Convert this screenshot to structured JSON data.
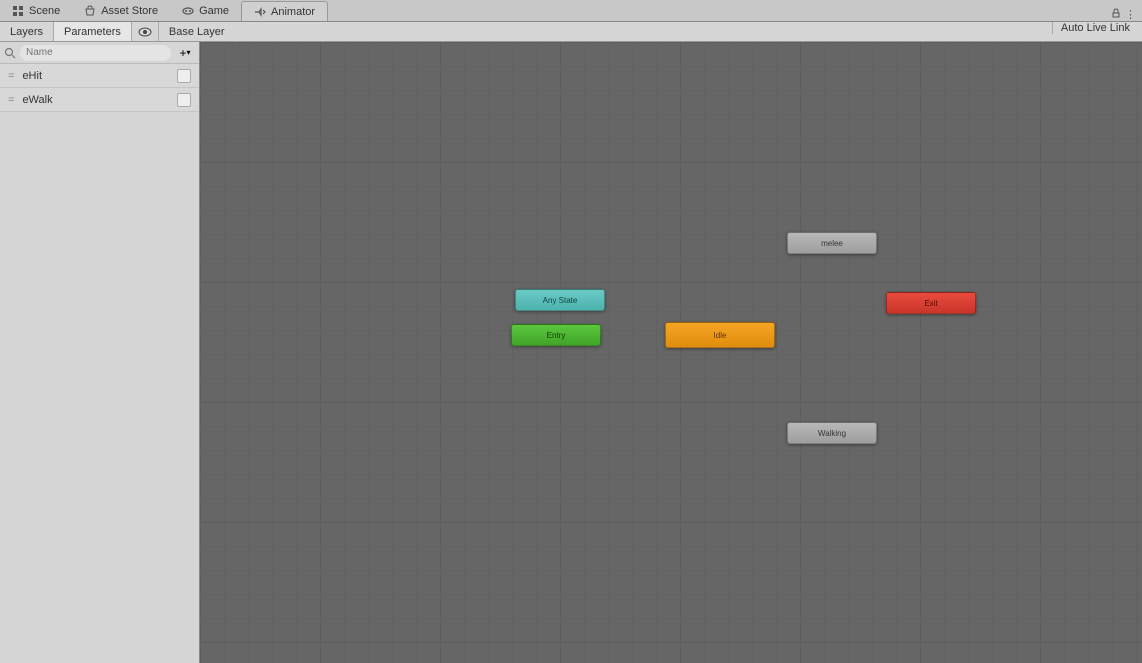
{
  "tabs": {
    "scene": "Scene",
    "asset_store": "Asset Store",
    "game": "Game",
    "animator": "Animator"
  },
  "sub_tabs": {
    "layers": "Layers",
    "parameters": "Parameters"
  },
  "breadcrumb": "Base Layer",
  "auto_live_link": "Auto Live Link",
  "search": {
    "placeholder": "Name"
  },
  "parameters": [
    {
      "name": "eHit"
    },
    {
      "name": "eWalk"
    }
  ],
  "nodes": {
    "any_state": "Any State",
    "entry": "Entry",
    "idle": "Idle",
    "melee": "melee",
    "walking": "Walking",
    "exit": "Exit"
  }
}
